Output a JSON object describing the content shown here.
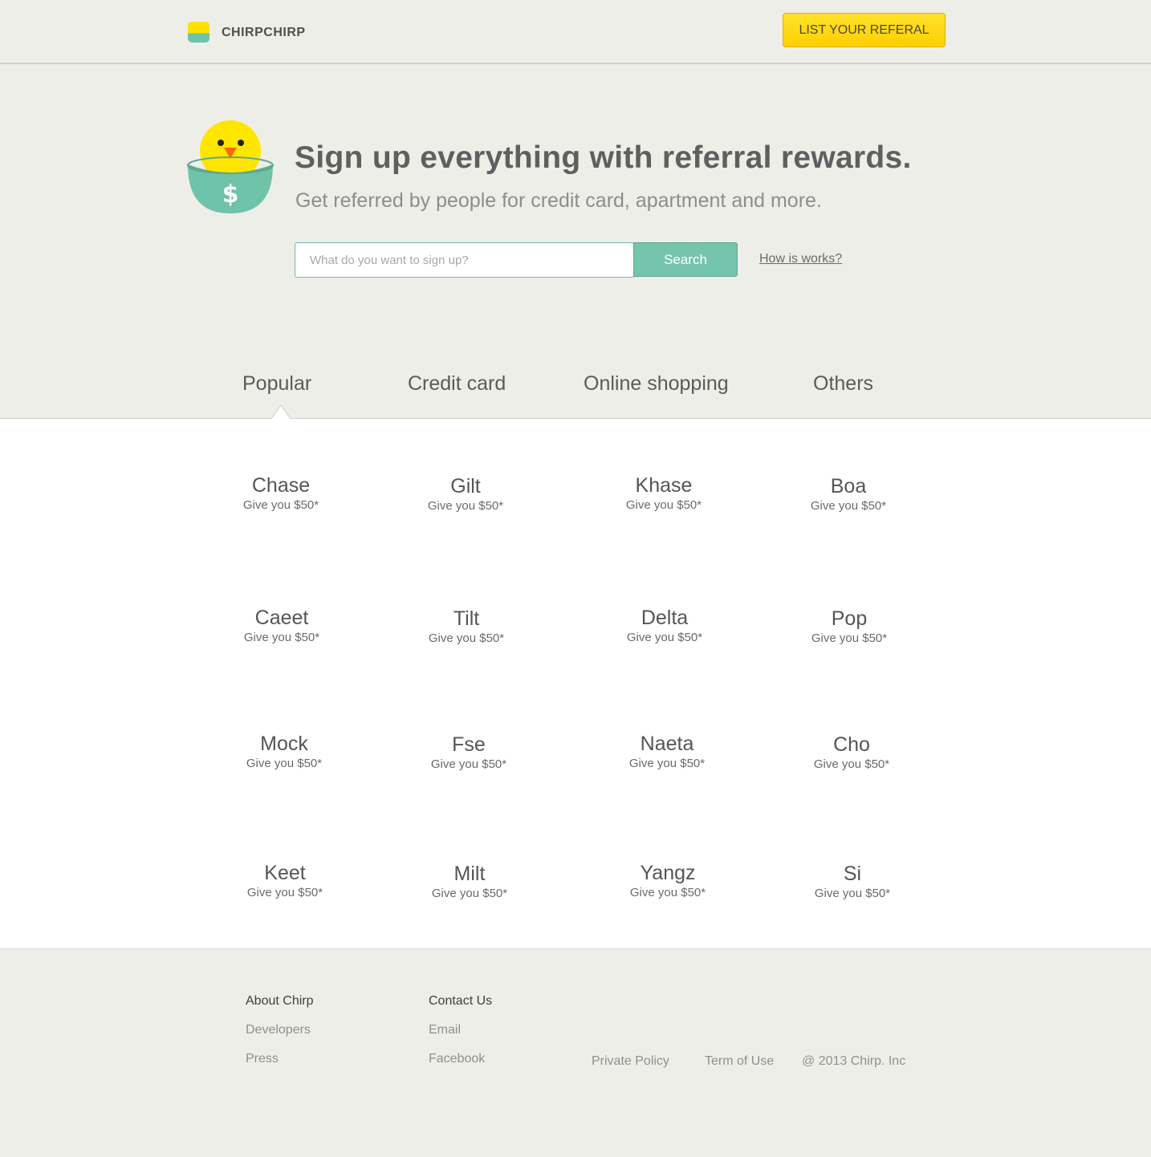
{
  "header": {
    "brand": "CHIRPCHIRP",
    "cta_label": "LIST YOUR REFERAL"
  },
  "hero": {
    "headline": "Sign up everything with referral rewards.",
    "subhead": "Get referred by people for credit card, apartment and more.",
    "search_placeholder": "What do you want to sign up?",
    "search_value": "",
    "search_button": "Search",
    "how_link": "How is works?"
  },
  "tabs": [
    {
      "label": "Popular",
      "active": true
    },
    {
      "label": "Credit card",
      "active": false
    },
    {
      "label": "Online shopping",
      "active": false
    },
    {
      "label": "Others",
      "active": false
    }
  ],
  "cards": [
    {
      "name": "Chase",
      "reward": "Give you $50*"
    },
    {
      "name": "Gilt",
      "reward": "Give you $50*"
    },
    {
      "name": "Khase",
      "reward": "Give you $50*"
    },
    {
      "name": "Boa",
      "reward": "Give you $50*"
    },
    {
      "name": "Caeet",
      "reward": "Give you $50*"
    },
    {
      "name": "Tilt",
      "reward": "Give you $50*"
    },
    {
      "name": "Delta",
      "reward": "Give you $50*"
    },
    {
      "name": "Pop",
      "reward": "Give you $50*"
    },
    {
      "name": "Mock",
      "reward": "Give you $50*"
    },
    {
      "name": "Fse",
      "reward": "Give you $50*"
    },
    {
      "name": "Naeta",
      "reward": "Give you $50*"
    },
    {
      "name": "Cho",
      "reward": "Give you $50*"
    },
    {
      "name": "Keet",
      "reward": "Give you $50*"
    },
    {
      "name": "Milt",
      "reward": "Give you $50*"
    },
    {
      "name": "Yangz",
      "reward": "Give you $50*"
    },
    {
      "name": "Si",
      "reward": "Give you $50*"
    }
  ],
  "footer": {
    "col1": {
      "heading": "About Chirp",
      "links": [
        "Developers",
        "Press"
      ]
    },
    "col2": {
      "heading": "Contact Us",
      "links": [
        "Email",
        "Facebook"
      ]
    },
    "legal": {
      "privacy": "Private Policy",
      "terms": "Term of Use",
      "copyright": "@ 2013 Chirp. Inc"
    }
  },
  "icons": {
    "logo": "logo-icon",
    "mascot": "chick-in-egg-dollar-icon"
  },
  "colors": {
    "background": "#eeeee9",
    "accent_yellow": "#ffd800",
    "accent_green": "#75c5ad",
    "text": "#5a5a5a"
  },
  "currency_symbol": "$"
}
